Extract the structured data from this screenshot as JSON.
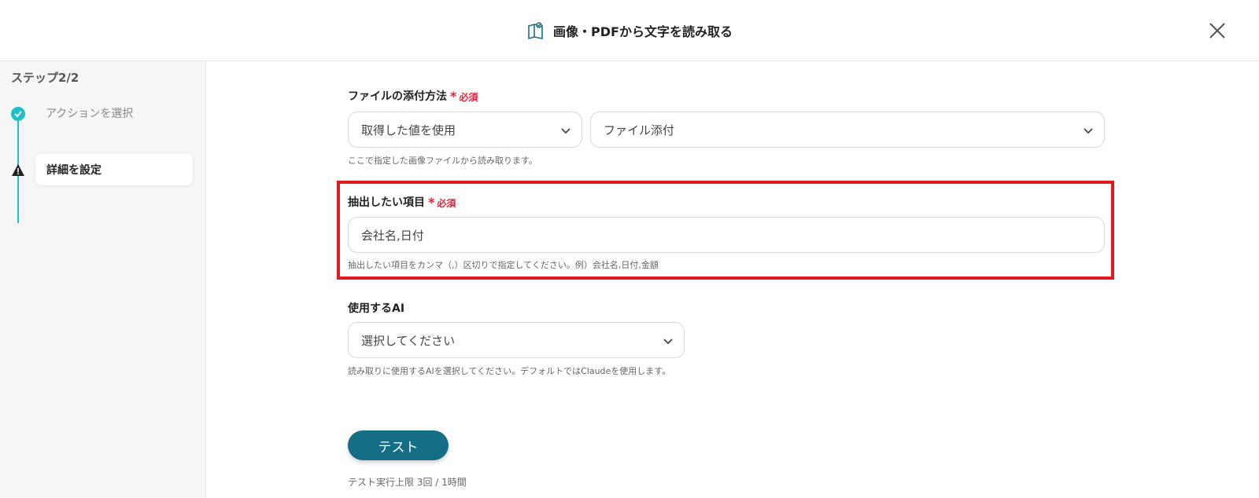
{
  "header": {
    "title": "画像・PDFから文字を読み取る",
    "title_icon": "book-page-icon",
    "close_icon": "close-icon"
  },
  "sidebar": {
    "step_count": "ステップ2/2",
    "steps": [
      {
        "label": "アクションを選択",
        "status": "done"
      },
      {
        "label": "詳細を設定",
        "status": "warning-current"
      }
    ]
  },
  "form": {
    "file_method": {
      "label": "ファイルの添付方法",
      "required": "必須",
      "select1_value": "取得した値を使用",
      "select2_value": "ファイル添付",
      "help": "ここで指定した画像ファイルから読み取ります。"
    },
    "extract_items": {
      "label": "抽出したい項目",
      "required": "必須",
      "value": "会社名,日付",
      "help": "抽出したい項目をカンマ（,）区切りで指定してください。例）会社名,日付,金額"
    },
    "ai": {
      "label": "使用するAI",
      "select_value": "選択してください",
      "help": "読み取りに使用するAIを選択してください。デフォルトではClaudeを使用します。"
    }
  },
  "test": {
    "button_label": "テスト",
    "limit": "テスト実行上限 3回 / 1時間"
  },
  "colors": {
    "accent_teal": "#1cc0c9",
    "button": "#146e86",
    "required_red": "#e5203a",
    "highlight_frame": "#e01b1b"
  }
}
